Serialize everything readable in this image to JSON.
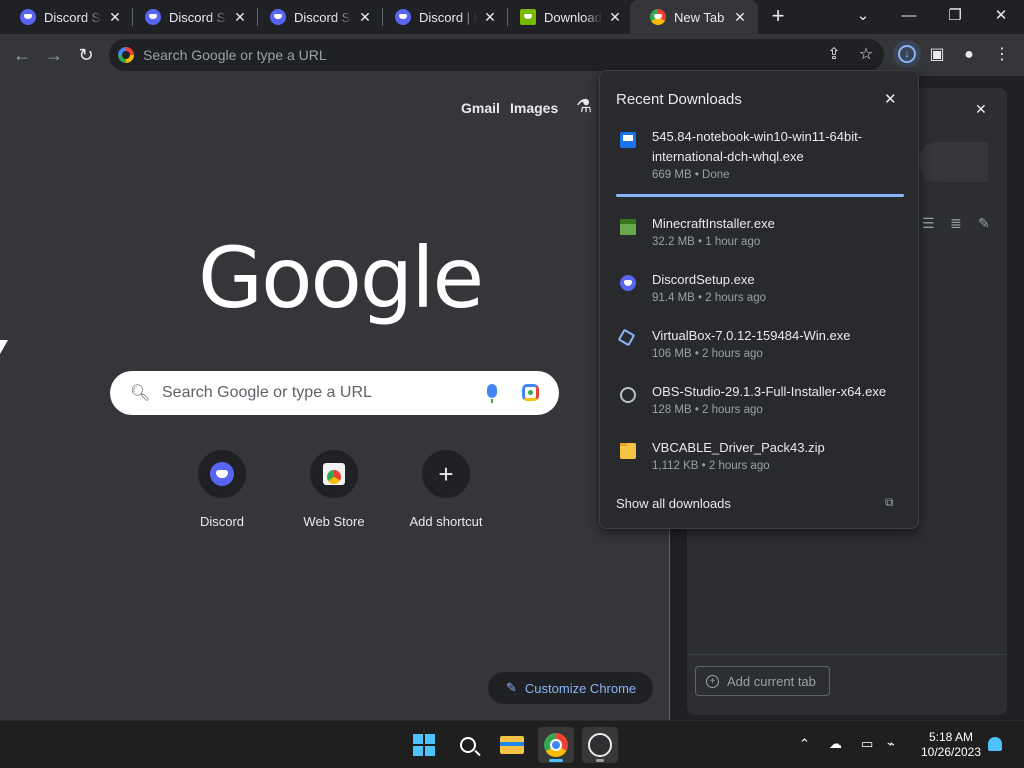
{
  "browser": {
    "tabs": [
      {
        "title": "Discord Staff",
        "icon": "discord-icon"
      },
      {
        "title": "Discord Staff",
        "icon": "discord-icon"
      },
      {
        "title": "Discord Staff",
        "icon": "discord-icon"
      },
      {
        "title": "Discord | F",
        "icon": "discord-icon"
      },
      {
        "title": "Download",
        "icon": "nvidia-icon"
      },
      {
        "title": "New Tab",
        "icon": "chrome-icon"
      }
    ],
    "omnibox_placeholder": "Search Google or type a URL"
  },
  "ntp": {
    "links": {
      "gmail": "Gmail",
      "images": "Images"
    },
    "logo": "Google",
    "search_placeholder": "Search Google or type a URL",
    "shortcuts": [
      {
        "label": "Discord"
      },
      {
        "label": "Web Store"
      },
      {
        "label": "Add shortcut"
      }
    ],
    "customize_label": "Customize Chrome"
  },
  "side_panel": {
    "add_tab_label": "Add current tab"
  },
  "downloads": {
    "title": "Recent Downloads",
    "items": [
      {
        "name": "545.84-notebook-win10-win11-64bit-international-dch-whql.exe",
        "meta": "669 MB • Done",
        "icon": "nvidia-file-icon"
      },
      {
        "name": "MinecraftInstaller.exe",
        "meta": "32.2 MB • 1 hour ago",
        "icon": "minecraft-icon"
      },
      {
        "name": "DiscordSetup.exe",
        "meta": "91.4 MB • 2 hours ago",
        "icon": "discord-icon"
      },
      {
        "name": "VirtualBox-7.0.12-159484-Win.exe",
        "meta": "106 MB • 2 hours ago",
        "icon": "virtualbox-icon"
      },
      {
        "name": "OBS-Studio-29.1.3-Full-Installer-x64.exe",
        "meta": "128 MB • 2 hours ago",
        "icon": "obs-icon"
      },
      {
        "name": "VBCABLE_Driver_Pack43.zip",
        "meta": "1,112 KB • 2 hours ago",
        "icon": "zip-icon"
      }
    ],
    "show_all": "Show all downloads"
  },
  "taskbar": {
    "time": "5:18 AM",
    "date": "10/26/2023"
  },
  "colors": {
    "accent": "#8ab4f8",
    "discord": "#5865f2",
    "windows_blue": "#4cc2ff"
  }
}
